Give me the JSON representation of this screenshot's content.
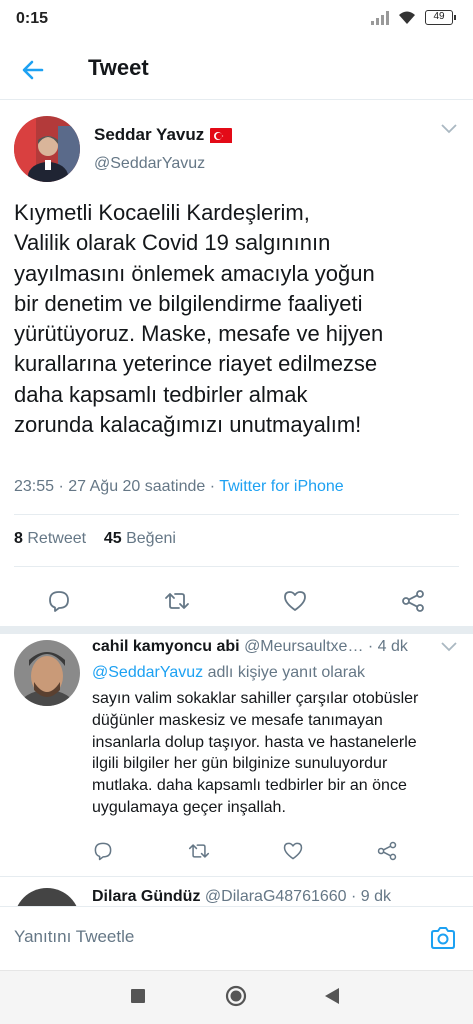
{
  "status_bar": {
    "time": "0:15",
    "battery": "49"
  },
  "header": {
    "title": "Tweet"
  },
  "tweet": {
    "author_name": "Seddar Yavuz",
    "author_handle": "@SeddarYavuz",
    "text_lines": [
      "Kıymetli Kocaelili Kardeşlerim,",
      "Valilik olarak Covid 19 salgınının",
      "yayılmasını önlemek amacıyla yoğun",
      "bir denetim ve bilgilendirme faaliyeti",
      "yürütüyoruz. Maske, mesafe ve hijyen",
      "kurallarına yeterince riayet edilmezse",
      "daha kapsamlı tedbirler almak",
      "zorunda kalacağımızı unutmayalım!"
    ],
    "timestamp": "23:55 · 27 Ağu 20 saatinde · ",
    "source": "Twitter for iPhone",
    "retweet_count": "8",
    "retweet_label": "Retweet",
    "like_count": "45",
    "like_label": "Beğeni"
  },
  "reply": {
    "author_name": "cahil kamyoncu abi",
    "author_handle": "@Meursaultxe…",
    "time": "· 4 dk",
    "reply_to_mention": "@SeddarYavuz",
    "reply_to_suffix": " adlı kişiye yanıt olarak",
    "text_lines": [
      "sayın valim sokaklar sahiller çarşılar otobüsler",
      "düğünler maskesiz ve mesafe tanımayan",
      "insanlarla dolup taşıyor. hasta ve hastanelerle",
      "ilgili bilgiler her gün bilginize sunuluyordur",
      "mutlaka. daha kapsamlı tedbirler bir an önce",
      "uygulamaya geçer inşallah."
    ]
  },
  "reply2": {
    "author_name": "Dilara Gündüz",
    "author_handle": "@DilaraG48761660",
    "time": "· 9 dk"
  },
  "compose": {
    "placeholder": "Yanıtını Tweetle"
  },
  "icons": {
    "back": "arrow-left-icon",
    "caret": "chevron-down-icon",
    "reply": "comment-icon",
    "retweet": "retweet-icon",
    "like": "heart-icon",
    "share": "share-icon",
    "camera": "camera-icon"
  },
  "colors": {
    "accent": "#1da1f2",
    "secondary_text": "#657786",
    "divider": "#e6ecf0"
  }
}
